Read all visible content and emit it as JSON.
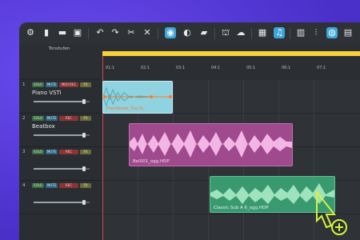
{
  "toolbar": {
    "icons": [
      "gear-icon",
      "new-file-icon",
      "open-file-icon",
      "save-icon",
      "undo-icon",
      "redo-icon",
      "cut-icon",
      "close-icon",
      "record-icon",
      "loop-icon",
      "folder-icon",
      "export-icon",
      "upload-cloud-icon",
      "grid-icon",
      "music-note-icon",
      "keyboard-icon",
      "mixer-icon",
      "plugin-icon",
      "more-icon"
    ],
    "active": [
      "record-icon",
      "music-note-icon",
      "plugin-icon"
    ]
  },
  "ruler": {
    "header_label": "Tonstufen",
    "marks": [
      "01:1",
      "02:1",
      "03:1",
      "04:1",
      "05:1",
      "06:1",
      "07:1"
    ]
  },
  "buttons": {
    "solo": "SOLO",
    "mute": "MUTE",
    "rec": "REC",
    "midi_rec": "MIDI REC",
    "fx": "FX"
  },
  "tracks": [
    {
      "num": "1",
      "name": "Piano VSTi",
      "rec_label": "MIDI REC",
      "volume": 0.9
    },
    {
      "num": "2",
      "name": "Beatbox",
      "rec_label": "REC",
      "volume": 0.9
    },
    {
      "num": "3",
      "name": "",
      "rec_label": "REC",
      "volume": 0.9
    },
    {
      "num": "4",
      "name": "",
      "rec_label": "REC",
      "volume": 0.9
    }
  ],
  "clips": [
    {
      "name": "Frambone_Sus R...",
      "track": 1,
      "color": "#8fd3e0",
      "text_color": "#ff7a20"
    },
    {
      "name": "Bel001_ogg.HDP",
      "track": 2,
      "color": "#a04a8e",
      "text_color": "#f7d7ef"
    },
    {
      "name": "Classic Sub A 6_ogg.HDP",
      "track": 4,
      "color": "#3a9a6f",
      "text_color": "#dff5e8"
    }
  ],
  "colors": {
    "accent": "#3ba6d8",
    "timeline": "#f5d23a",
    "playhead": "#e0454e",
    "cursor": "#d7f23b"
  }
}
